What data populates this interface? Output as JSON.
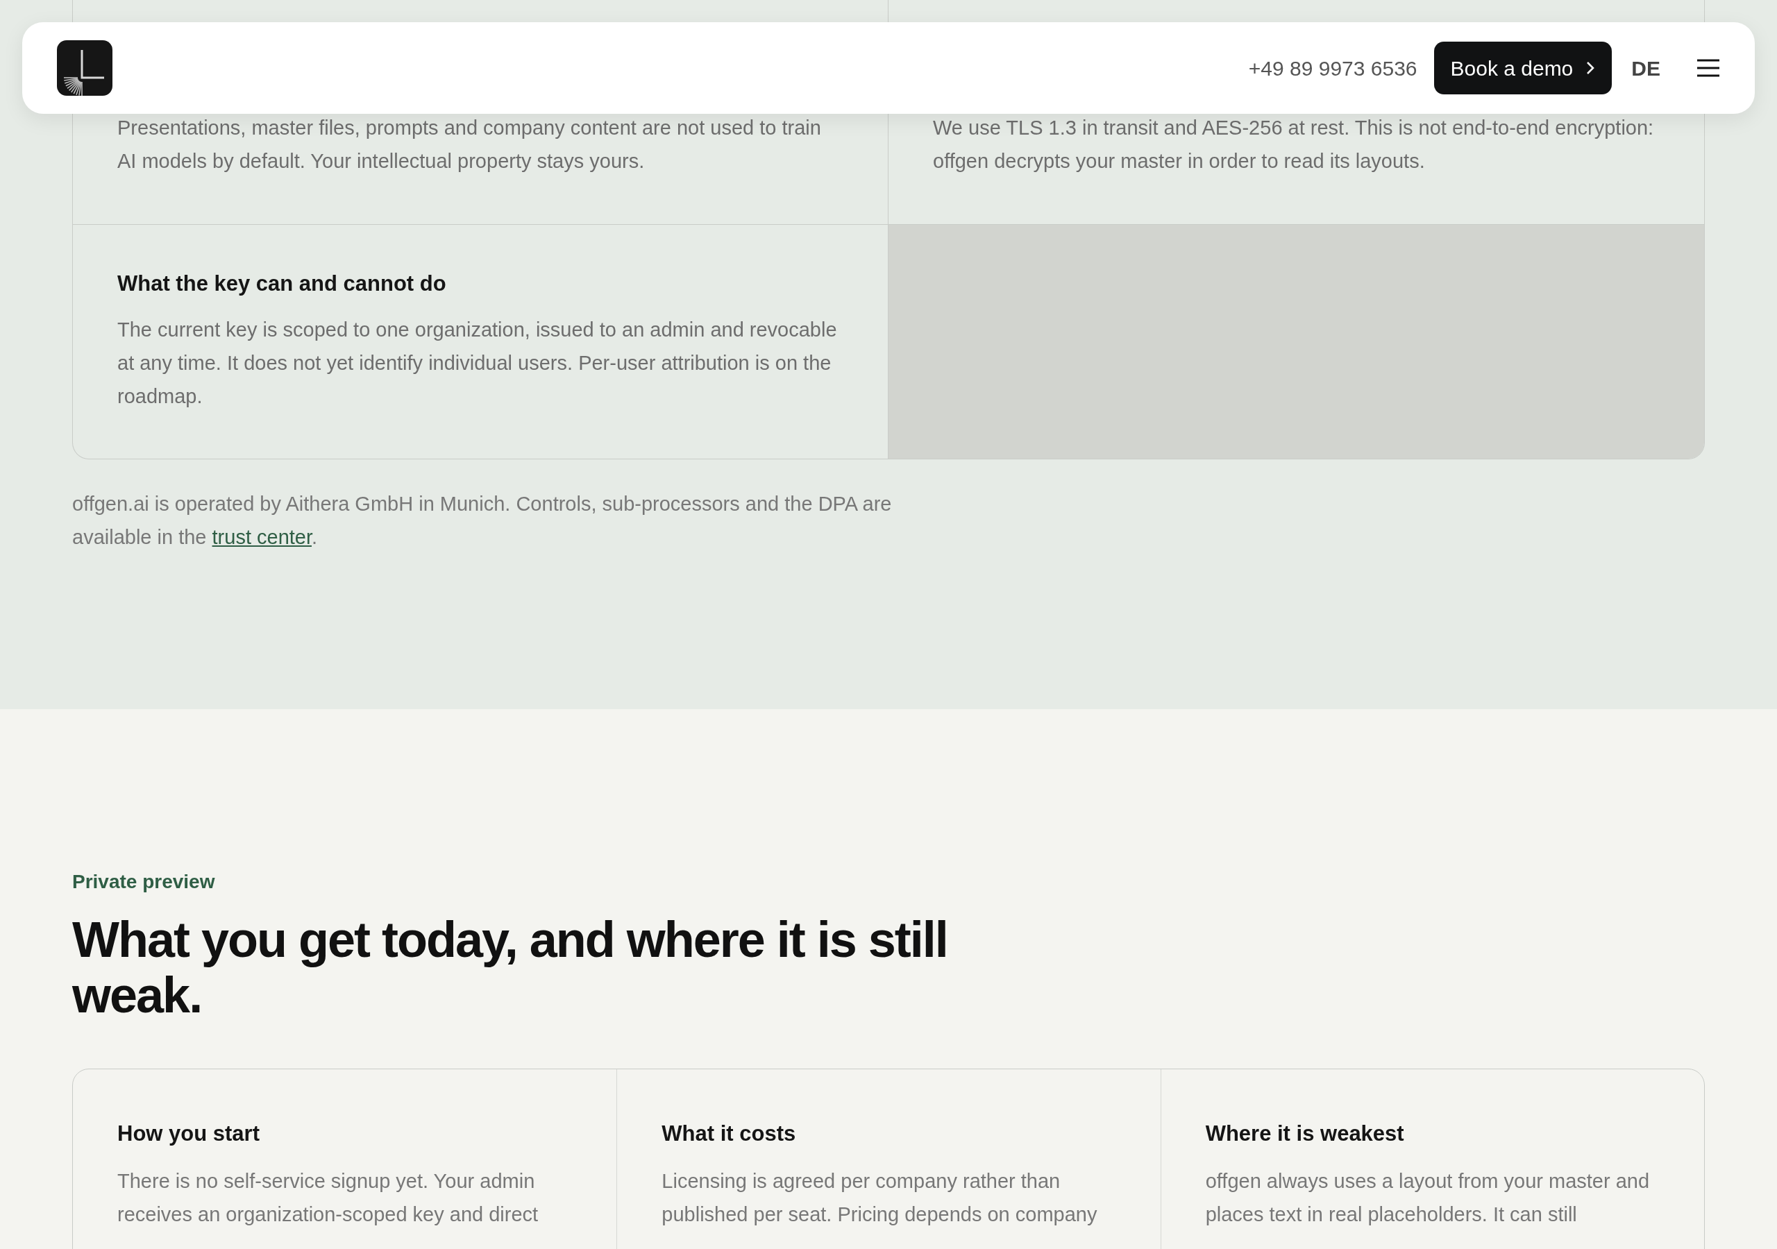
{
  "header": {
    "phone": "+49 89 9973 6536",
    "cta": "Book a demo",
    "language": "DE"
  },
  "security": {
    "cells": [
      {
        "kind": "text",
        "body": "Presentations, master files, prompts and company content are not used to train AI models by default. Your intellectual property stays yours."
      },
      {
        "kind": "text",
        "body": "We use TLS 1.3 in transit and AES-256 at rest. This is not end-to-end encryption: offgen decrypts your master in order to read its layouts."
      },
      {
        "kind": "text",
        "title": "What the key can and cannot do",
        "body": "The current key is scoped to one organization, issued to an admin and revocable at any time. It does not yet identify individual users. Per-user attribution is on the roadmap."
      },
      {
        "kind": "empty"
      }
    ],
    "note": {
      "before": "offgen.ai is operated by Aithera GmbH in Munich. Controls, sub-processors and the DPA are available in the",
      "link": "trust center",
      "after": "."
    }
  },
  "preview": {
    "eyebrow": "Private preview",
    "heading": "What you get today, and where it is still weak.",
    "cards": [
      {
        "title": "How you start",
        "body": "There is no self-service signup yet. Your admin receives an organization-scoped key and direct"
      },
      {
        "title": "What it costs",
        "body": "Licensing is agreed per company rather than published per seat. Pricing depends on company"
      },
      {
        "title": "Where it is weakest",
        "body": "offgen always uses a layout from your master and places text in real placeholders. It can still"
      }
    ]
  }
}
